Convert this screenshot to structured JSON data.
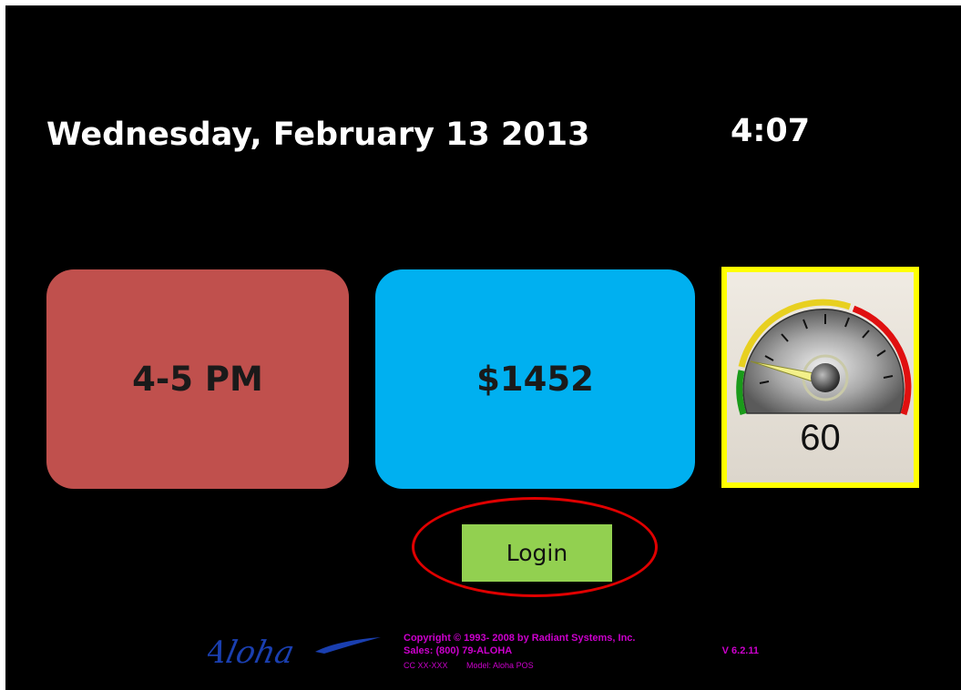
{
  "header": {
    "date": "Wednesday, February 13 2013",
    "time": "4:07"
  },
  "tiles": {
    "hour_label": "4-5 PM",
    "sales_label": "$1452"
  },
  "gauge": {
    "value": "60",
    "scale_colors": [
      "#1a9a1a",
      "#e8d020",
      "#e01010"
    ]
  },
  "login": {
    "label": "Login"
  },
  "footer": {
    "logo_text": "Aloha",
    "copyright": "Copyright © 1993- 2008 by Radiant Systems, Inc.",
    "sales": "Sales: (800) 79-ALOHA",
    "version": "V 6.2.11",
    "cc": "CC XX-XXX",
    "model": "Model: Aloha POS"
  },
  "colors": {
    "hour_tile": "#c0504d",
    "sales_tile": "#00b0f0",
    "gauge_frame": "#ffff00",
    "login_button": "#92d050",
    "highlight_ring": "#e00000",
    "footer_text": "#cc00cc"
  }
}
